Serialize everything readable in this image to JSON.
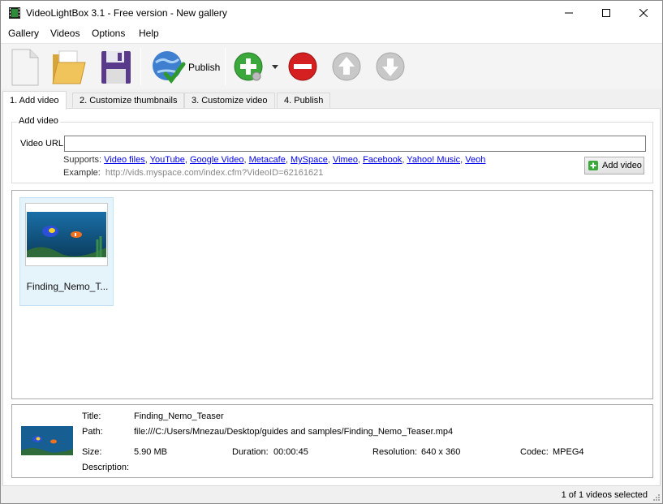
{
  "window": {
    "title": "VideoLightBox 3.1 - Free version - New gallery"
  },
  "menu": [
    "Gallery",
    "Videos",
    "Options",
    "Help"
  ],
  "toolbar": {
    "icons": [
      "new-gallery-icon",
      "open-folder-icon",
      "save-floppy-icon",
      "publish-globe-icon",
      "add-green-icon",
      "remove-red-icon",
      "move-up-icon",
      "move-down-icon"
    ],
    "publish_label": "Publish"
  },
  "tabs": [
    {
      "label": "1. Add video",
      "active": true
    },
    {
      "label": "2. Customize thumbnails",
      "active": false
    },
    {
      "label": "3. Customize video",
      "active": false
    },
    {
      "label": "4. Publish",
      "active": false
    }
  ],
  "add_video": {
    "group_label": "Add video",
    "url_label": "Video URL",
    "url_value": "",
    "supports_label": "Supports:",
    "supports_links": [
      "Video files",
      "YouTube",
      "Google Video",
      "Metacafe",
      "MySpace",
      "Vimeo",
      "Facebook",
      "Yahoo! Music",
      "Veoh"
    ],
    "example_label": "Example:",
    "example_url": "http://vids.myspace.com/index.cfm?VideoID=62161621",
    "add_button": "Add video"
  },
  "gallery": {
    "items": [
      {
        "caption": "Finding_Nemo_T...",
        "selected": true
      }
    ]
  },
  "details": {
    "title_label": "Title:",
    "title_value": "Finding_Nemo_Teaser",
    "path_label": "Path:",
    "path_value": "file:///C:/Users/Mnezau/Desktop/guides and samples/Finding_Nemo_Teaser.mp4",
    "size_label": "Size:",
    "size_value": "5.90 MB",
    "duration_label": "Duration:",
    "duration_value": "00:00:45",
    "resolution_label": "Resolution:",
    "resolution_value": "640 x 360",
    "codec_label": "Codec:",
    "codec_value": "MPEG4",
    "description_label": "Description:",
    "description_value": ""
  },
  "status": {
    "text": "1 of 1 videos selected"
  },
  "colors": {
    "selection_bg": "#e5f3fb",
    "link": "#0000ee",
    "add_green": "#3aa83a",
    "remove_red": "#d42020"
  }
}
